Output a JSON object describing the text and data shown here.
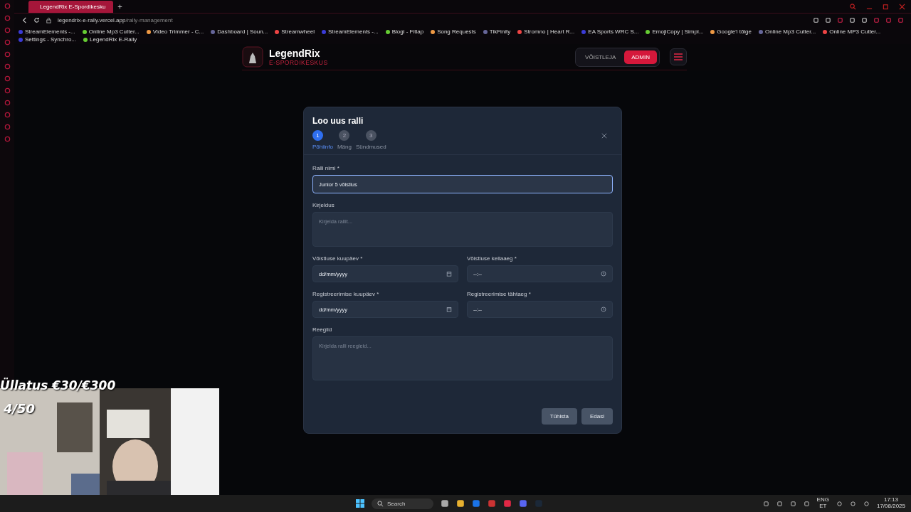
{
  "browser": {
    "tab": {
      "title": "LegendRix E-Spordikesku",
      "selected": true
    },
    "address": {
      "host": "legendrix-e-rally.vercel.app",
      "path": "/rally-management"
    },
    "bookmarks": [
      "StreamElements -...",
      "Online Mp3 Cutter...",
      "Video Trimmer - C...",
      "Dashboard | Soun...",
      "Streamwheel",
      "StreamElements -...",
      "Blogi - Fitlap",
      "Song Requests",
      "TikFinity",
      "Stromno | Heart R...",
      "EA Sports WRC S...",
      "EmojiCopy | Simpl...",
      "Google'i tõlge",
      "Online Mp3 Cutter...",
      "Online MP3 Cutter...",
      "Settings - Synchro...",
      "LegendRix E-Rally"
    ]
  },
  "header": {
    "brand": "LegendRix",
    "subtitle": "E-SPORDIKESKUS",
    "roles": [
      {
        "label": "VÕISTLEJA",
        "selected": false
      },
      {
        "label": "ADMIN",
        "selected": true
      }
    ]
  },
  "modal": {
    "title": "Loo uus ralli",
    "steps": [
      {
        "number": "1",
        "label": "Põhiinfo",
        "selected": true
      },
      {
        "number": "2",
        "label": "Mäng",
        "selected": false
      },
      {
        "number": "3",
        "label": "Sündmused",
        "selected": false
      }
    ],
    "fields": [
      {
        "kind": "text",
        "label": "Ralli nimi *",
        "value": "Junior 5 võistlus",
        "focused": true
      },
      {
        "kind": "textarea",
        "label": "Kirjeldus",
        "placeholder": "Kirjelda rallit...",
        "focused": false
      },
      {
        "kind": "date",
        "label": "Võistluse kuupäev *",
        "placeholder": "dd/mm/yyyy",
        "focused": false
      },
      {
        "kind": "time",
        "label": "Võistluse kellaaeg *",
        "placeholder": "--:--",
        "focused": false
      },
      {
        "kind": "date",
        "label": "Registreerimise kuupäev *",
        "placeholder": "dd/mm/yyyy",
        "focused": false
      },
      {
        "kind": "time",
        "label": "Registreerimise tähtaeg *",
        "placeholder": "--:--",
        "focused": false
      },
      {
        "kind": "textarea",
        "label": "Reeglid",
        "placeholder": "Kirjelda ralli reegleid...",
        "focused": false
      }
    ],
    "buttons": [
      "Tühista",
      "Edasi"
    ]
  },
  "overlay": {
    "goal": "Üllatus €30/€300",
    "count": "4/50"
  },
  "taskbar": {
    "search": "Search",
    "language": "ENG",
    "layout": "ET",
    "time": "17:13",
    "date": "17/08/2025"
  }
}
